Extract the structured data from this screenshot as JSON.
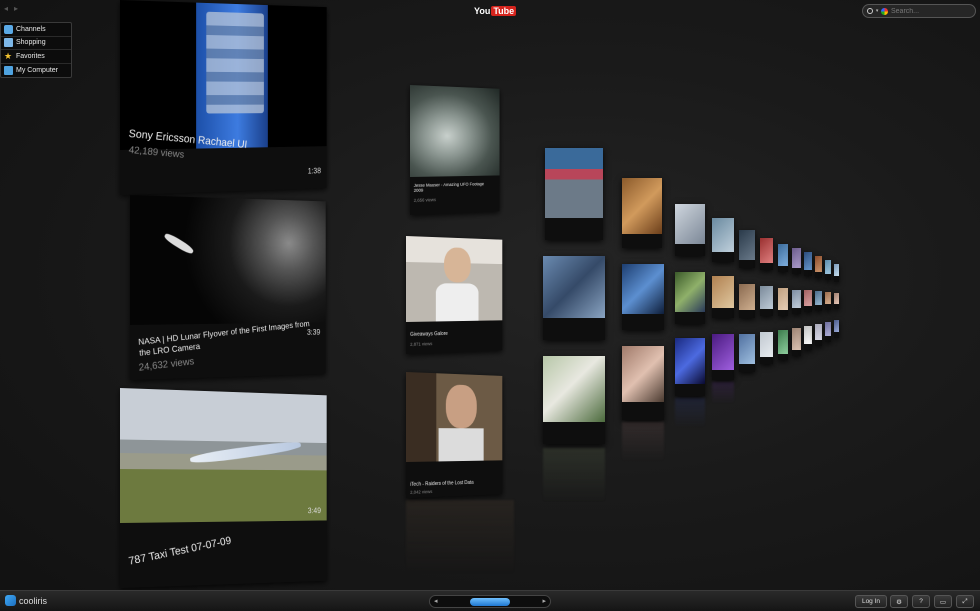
{
  "nav": {
    "back": "◂",
    "forward": "▸"
  },
  "sidebar": {
    "items": [
      {
        "label": "Channels",
        "icon": "channels-icon",
        "color": "#5aa9e6"
      },
      {
        "label": "Shopping",
        "icon": "shopping-icon",
        "color": "#7db7e8"
      },
      {
        "label": "Favorites",
        "icon": "star-icon",
        "color": "#f4c430"
      },
      {
        "label": "My Computer",
        "icon": "computer-icon",
        "color": "#4fa3e0"
      }
    ]
  },
  "header": {
    "logo_you": "You",
    "logo_tube": "Tube"
  },
  "search": {
    "placeholder": "Search..."
  },
  "videos": [
    {
      "title": "Sony Ericsson Rachael UI",
      "views": "42,189 views",
      "duration": "1:38"
    },
    {
      "title": "NASA | HD Lunar Flyover of the First Images from the LRO Camera",
      "views": "24,632 views",
      "duration": "3:39"
    },
    {
      "title": "787 Taxi Test 07-07-09",
      "views": "",
      "duration": "3:49"
    },
    {
      "title": "Jesse Mauser - Amazing UFO Footage 2009",
      "views": "2,656 views",
      "duration": ""
    },
    {
      "title": "Giveaways Galore",
      "views": "2,871 views",
      "duration": ""
    },
    {
      "title": "iTech - Raiders of the Lost Data",
      "views": "2,042 views",
      "duration": ""
    }
  ],
  "bottombar": {
    "brand": "cooliris",
    "login_label": "Log In",
    "help_label": "?",
    "gear_label": "⚙",
    "display_label": "▭",
    "fullscreen_label": "⤢",
    "scroll_left": "◂",
    "scroll_right": "▸"
  },
  "colors": {
    "accent": "#1f77d0",
    "youtube_red": "#d6241d",
    "background": "#161616"
  }
}
